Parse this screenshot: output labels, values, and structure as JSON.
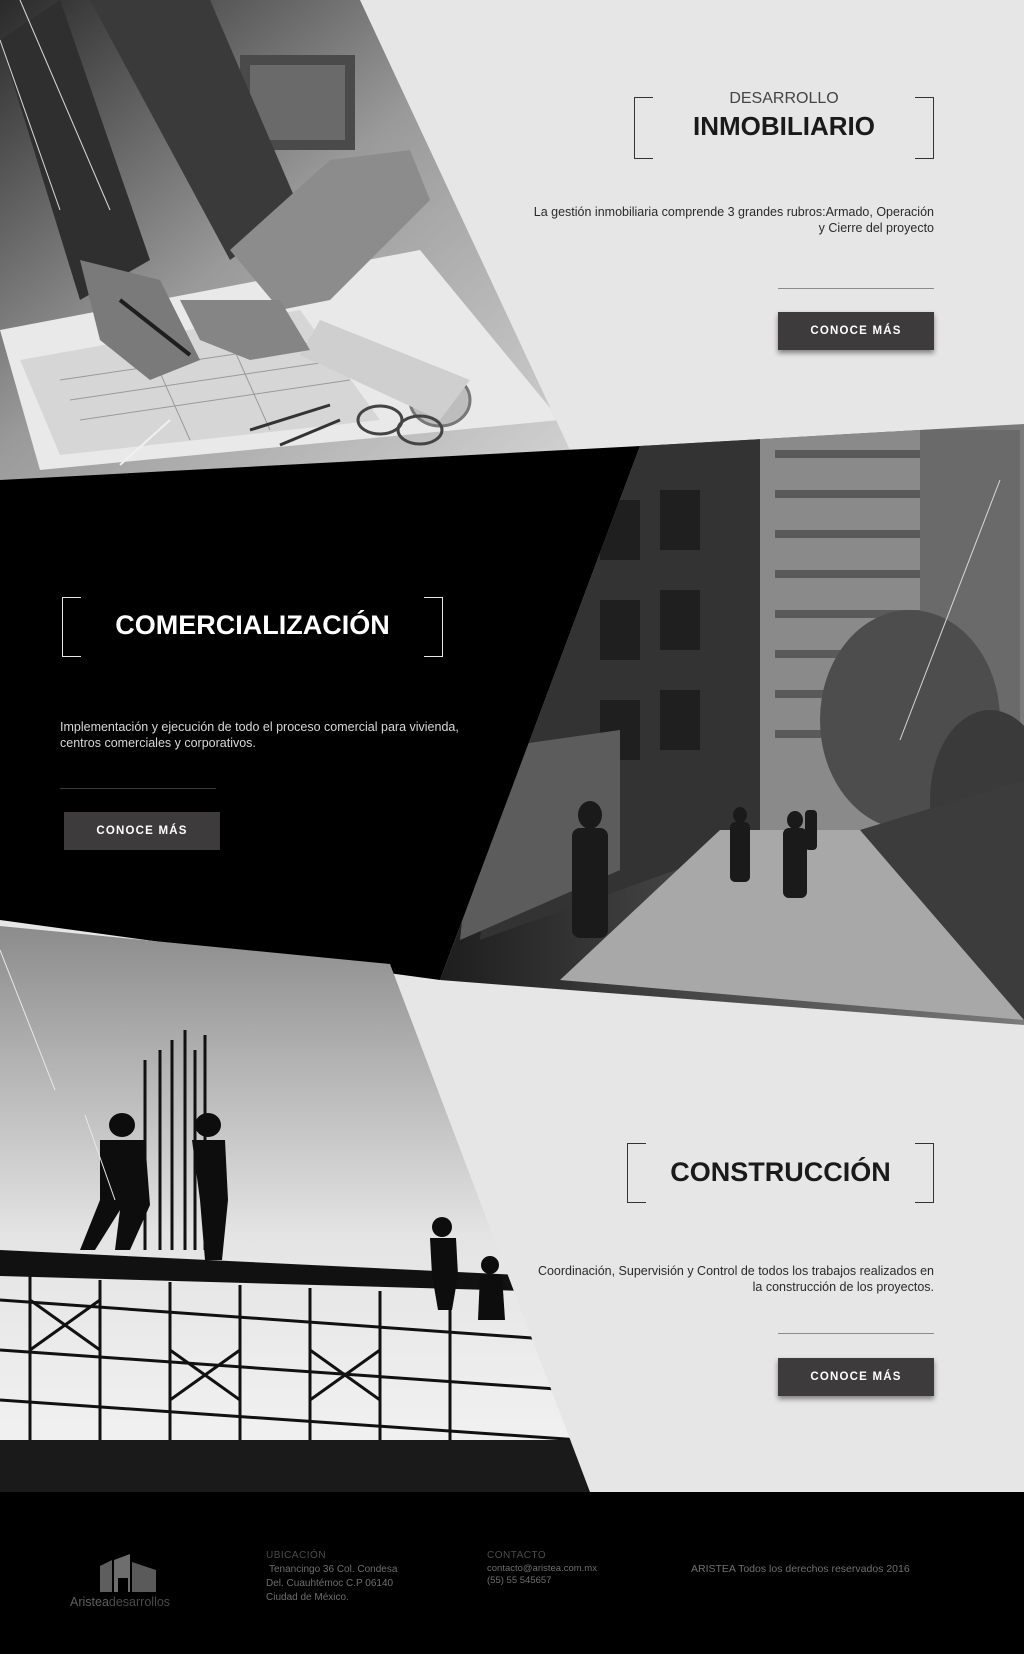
{
  "sections": [
    {
      "subtitle": "DESARROLLO",
      "title": "INMOBILIARIO",
      "description_line1": "La gestión inmobiliaria comprende 3 grandes rubros:Armado, Operación",
      "description_line2": "y Cierre del proyecto",
      "button": "CONOCE MÁS"
    },
    {
      "title": "COMERCIALIZACIÓN",
      "description_line1": "Implementación y ejecución de todo el proceso comercial para vivienda,",
      "description_line2": "centros comerciales y corporativos.",
      "button": "CONOCE MÁS"
    },
    {
      "title": "CONSTRUCCIÓN",
      "description_line1": "Coordinación, Supervisión y Control de todos los trabajos realizados en",
      "description_line2": "la construcción de los proyectos.",
      "button": "CONOCE MÁS"
    }
  ],
  "footer": {
    "logo_text_bold": "Aristea",
    "logo_text_light": "desarrollos",
    "ubicacion_label": "UBICACIÓN",
    "address_line1": "Tenancingo 36 Col. Condesa",
    "address_line2": "Del. Cuauhtémoc C.P 06140",
    "address_line3": "Ciudad de México.",
    "contacto_label": "CONTACTO",
    "email": "contacto@aristea.com.mx",
    "phone": "(55) 55 545657",
    "copyright": "ARISTEA Todos los derechos reservados 2016"
  },
  "colors": {
    "light_bg": "#e6e6e6",
    "dark_bg": "#000000",
    "button_dark": "#3e3b3c"
  }
}
